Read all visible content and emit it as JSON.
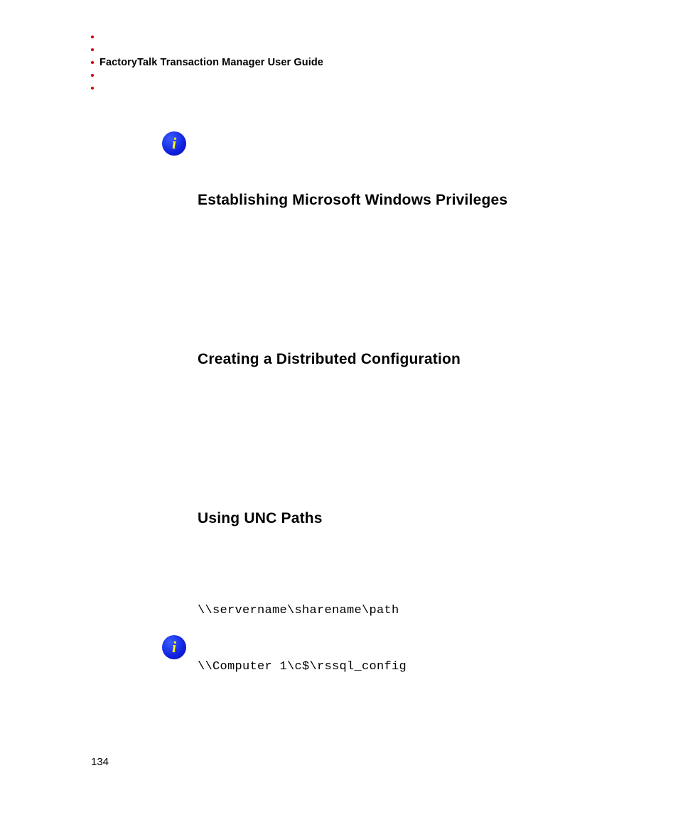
{
  "header": {
    "running_title": "FactoryTalk Transaction Manager User Guide"
  },
  "sections": {
    "heading1": "Establishing Microsoft Windows Privileges",
    "heading2": "Creating a Distributed Configuration",
    "heading3": "Using UNC Paths",
    "code1": "\\\\servername\\sharename\\path",
    "code2": "\\\\Computer 1\\c$\\rssql_config"
  },
  "footer": {
    "page_number": "134"
  }
}
